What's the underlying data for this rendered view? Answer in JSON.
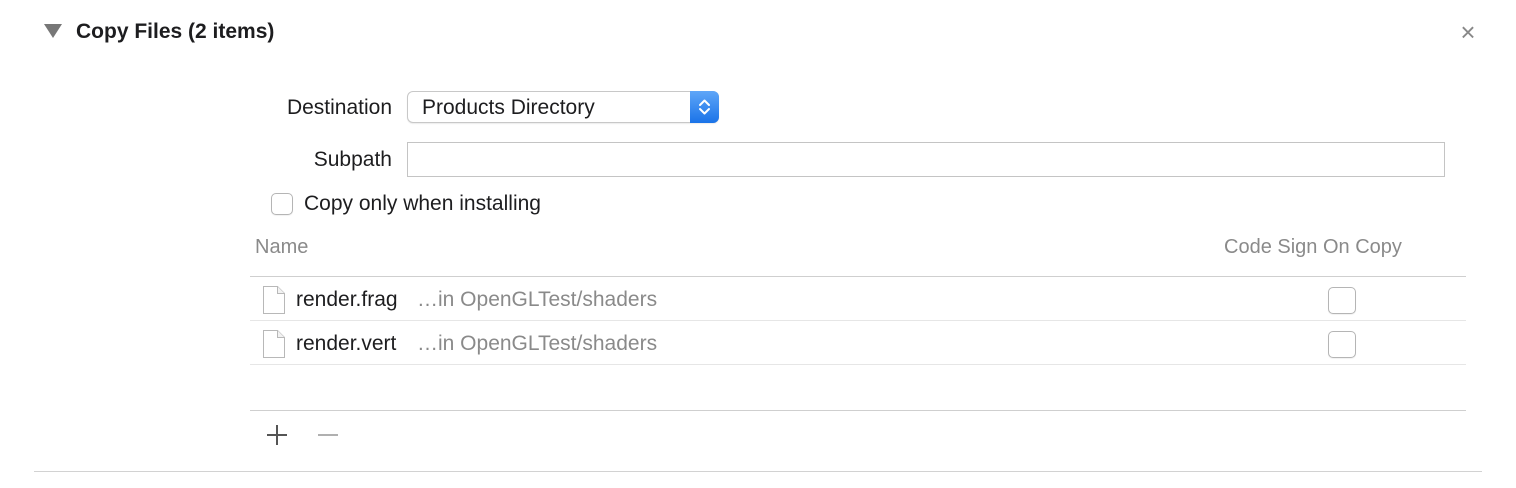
{
  "section": {
    "title": "Copy Files (2 items)",
    "close_symbol": "×"
  },
  "form": {
    "destination_label": "Destination",
    "destination_value": "Products Directory",
    "subpath_label": "Subpath",
    "subpath_value": "",
    "copy_only_label": "Copy only when installing",
    "copy_only_checked": false
  },
  "table": {
    "headers": {
      "name": "Name",
      "code_sign": "Code Sign On Copy"
    },
    "rows": [
      {
        "name": "render.frag",
        "path": "…in OpenGLTest/shaders",
        "code_sign": false,
        "icon": "file-icon"
      },
      {
        "name": "render.vert",
        "path": "…in OpenGLTest/shaders",
        "code_sign": false,
        "icon": "file-icon"
      }
    ]
  },
  "toolbar": {
    "add_icon": "plus-icon",
    "remove_icon": "minus-icon"
  },
  "colors": {
    "accent": "#1a73e8",
    "secondary_text": "#8a8a8a"
  }
}
